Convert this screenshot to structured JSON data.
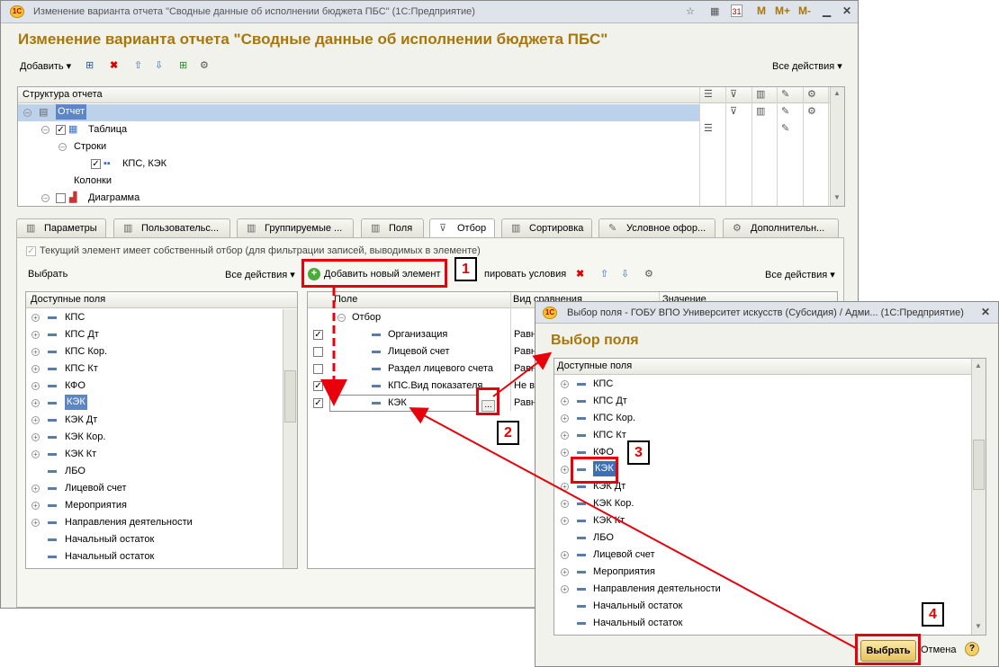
{
  "main": {
    "title": "Изменение варианта отчета \"Сводные данные об исполнении бюджета ПБС\"  (1С:Предприятие)",
    "heading": "Изменение варианта отчета \"Сводные данные об исполнении бюджета ПБС\"",
    "title_buttons": [
      "М",
      "М+",
      "М-"
    ],
    "toolbar": {
      "add": "Добавить",
      "all_actions": "Все действия"
    },
    "structure": {
      "header": "Структура отчета",
      "rows": [
        {
          "label": "Отчет"
        },
        {
          "label": "Таблица"
        },
        {
          "label": "Строки"
        },
        {
          "label": "КПС, КЭК"
        },
        {
          "label": "Колонки"
        },
        {
          "label": "Диаграмма"
        }
      ]
    },
    "tabs": [
      "Параметры",
      "Пользовательс...",
      "Группируемые ...",
      "Поля",
      "Отбор",
      "Сортировка",
      "Условное офор...",
      "Дополнительн..."
    ],
    "own_filter_label": "Текущий элемент имеет собственный отбор (для фильтрации записей, выводимых в элементе)",
    "left_toolbar": {
      "choose": "Выбрать",
      "all_actions": "Все действия"
    },
    "right_toolbar": {
      "add_new": "Добавить новый элемент",
      "group_conditions": "пировать условия",
      "all_actions": "Все действия"
    },
    "available_fields": {
      "header": "Доступные поля",
      "items": [
        "КПС",
        "КПС Дт",
        "КПС Кор.",
        "КПС Кт",
        "КФО",
        "КЭК",
        "КЭК Дт",
        "КЭК Кор.",
        "КЭК Кт",
        "ЛБО",
        "Лицевой счет",
        "Мероприятия",
        "Направления деятельности",
        "Начальный остаток",
        "Начальный остаток"
      ]
    },
    "filter": {
      "headers": {
        "field": "Поле",
        "comparison": "Вид сравнения",
        "value": "Значение"
      },
      "group": "Отбор",
      "rows": [
        {
          "field": "Организация",
          "comparison": "Равн"
        },
        {
          "field": "Лицевой счет",
          "comparison": "Равн"
        },
        {
          "field": "Раздел лицевого счета",
          "comparison": "Равн"
        },
        {
          "field": "КПС.Вид показателя",
          "comparison": "Не в"
        },
        {
          "field": "КЭК",
          "comparison": "Равн"
        }
      ],
      "ellipsis": "..."
    }
  },
  "dialog": {
    "title": "Выбор поля - ГОБУ ВПО Университет искусств (Субсидия) / Адми...  (1С:Предприятие)",
    "heading": "Выбор поля",
    "list_header": "Доступные поля",
    "items": [
      "КПС",
      "КПС Дт",
      "КПС Кор.",
      "КПС Кт",
      "КФО",
      "КЭК",
      "КЭК Дт",
      "КЭК Кор.",
      "КЭК Кт",
      "ЛБО",
      "Лицевой счет",
      "Мероприятия",
      "Направления деятельности",
      "Начальный остаток",
      "Начальный остаток"
    ],
    "choose_button": "Выбрать",
    "cancel_button": "Отмена",
    "help": "?"
  },
  "annotations": [
    "1",
    "2",
    "3",
    "4"
  ],
  "colors": {
    "accent_heading": "#a8760a",
    "selection": "#bcd1ea",
    "annotation_red": "#e8000a"
  }
}
